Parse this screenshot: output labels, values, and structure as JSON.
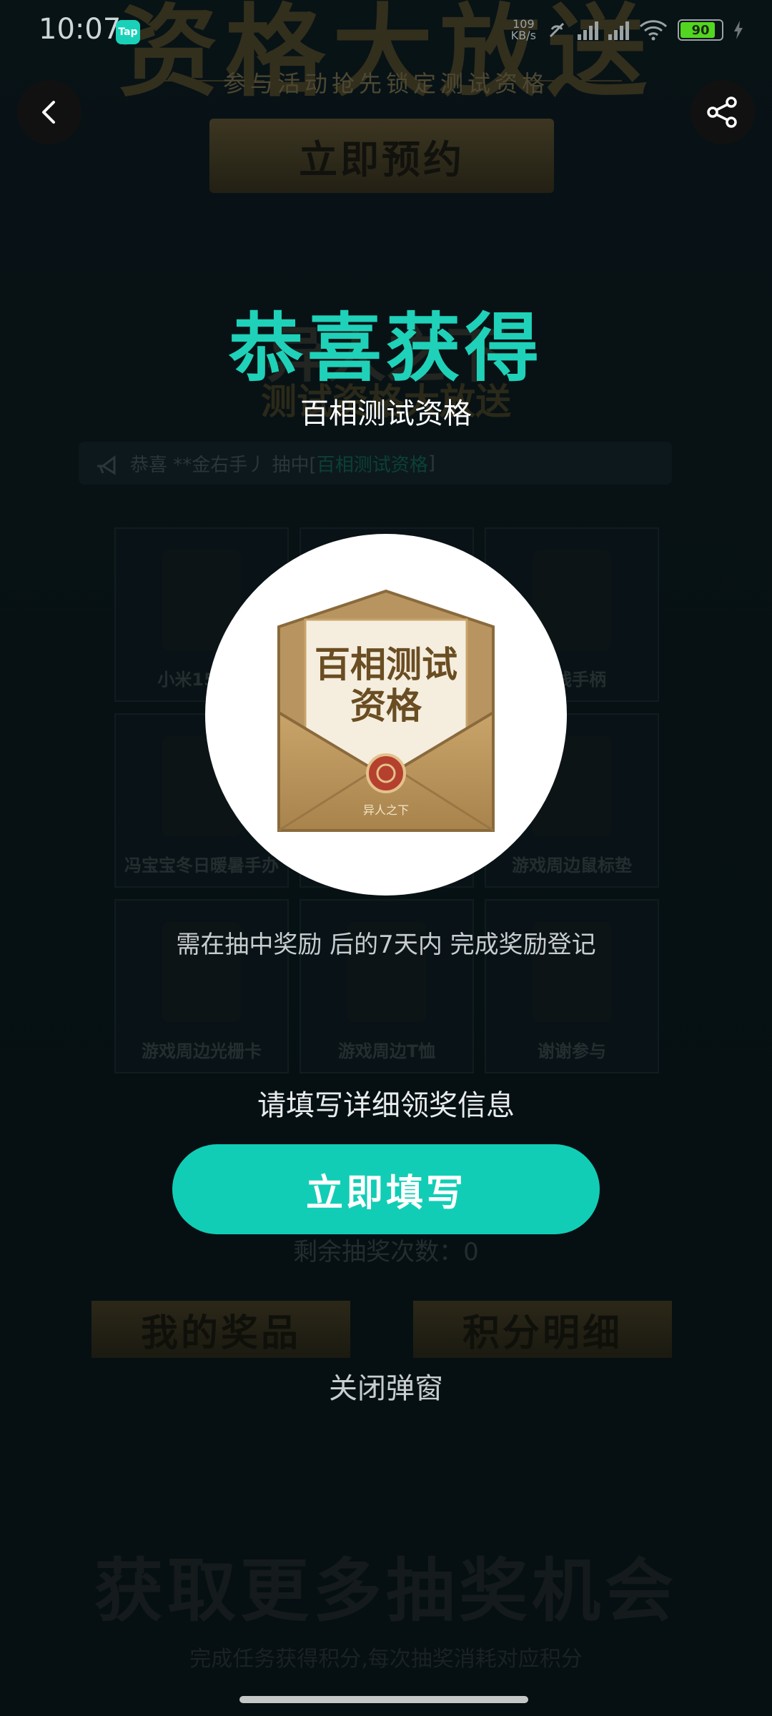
{
  "status_bar": {
    "time": "10:07",
    "app_icon": "Tap",
    "speed_value": "109",
    "speed_unit": "KB/s",
    "battery": "90"
  },
  "background": {
    "hero_title": "资格大放送",
    "tagline": "参与活动抢先锁定测试资格",
    "reserve_button": "立即预约",
    "section_title": "异人之下",
    "section_sub": "测试资格大放送",
    "marquee_prefix": "恭喜 **金右手丿 抽中[",
    "marquee_prize": "百相测试资格",
    "marquee_suffix": "]",
    "grid_items": [
      "小米15 16",
      "",
      "无线手柄",
      "冯宝宝冬日暖暑手办",
      "",
      "游戏周边鼠标垫",
      "游戏周边光栅卡",
      "游戏周边T恤",
      "谢谢参与"
    ],
    "remaining_label": "剩余抽奖次数：",
    "remaining_value": "0",
    "tab_prizes": "我的奖品",
    "tab_points": "积分明细",
    "more_title": "获取更多抽奖机会",
    "more_sub": "完成任务获得积分,每次抽奖消耗对应积分"
  },
  "popup": {
    "title": "恭喜获得",
    "prize_name": "百相测试资格",
    "prize_image_text_line1": "百相测试",
    "prize_image_text_line2": "资格",
    "prize_image_seal": "异人之下",
    "note": "需在抽中奖励 后的7天内 完成奖励登记",
    "instruction": "请填写详细领奖信息",
    "fill_button": "立即填写",
    "close": "关闭弹窗"
  },
  "colors": {
    "accent": "#12cdb5",
    "title_green": "#1fd1b8",
    "gold": "#c9a46a"
  }
}
